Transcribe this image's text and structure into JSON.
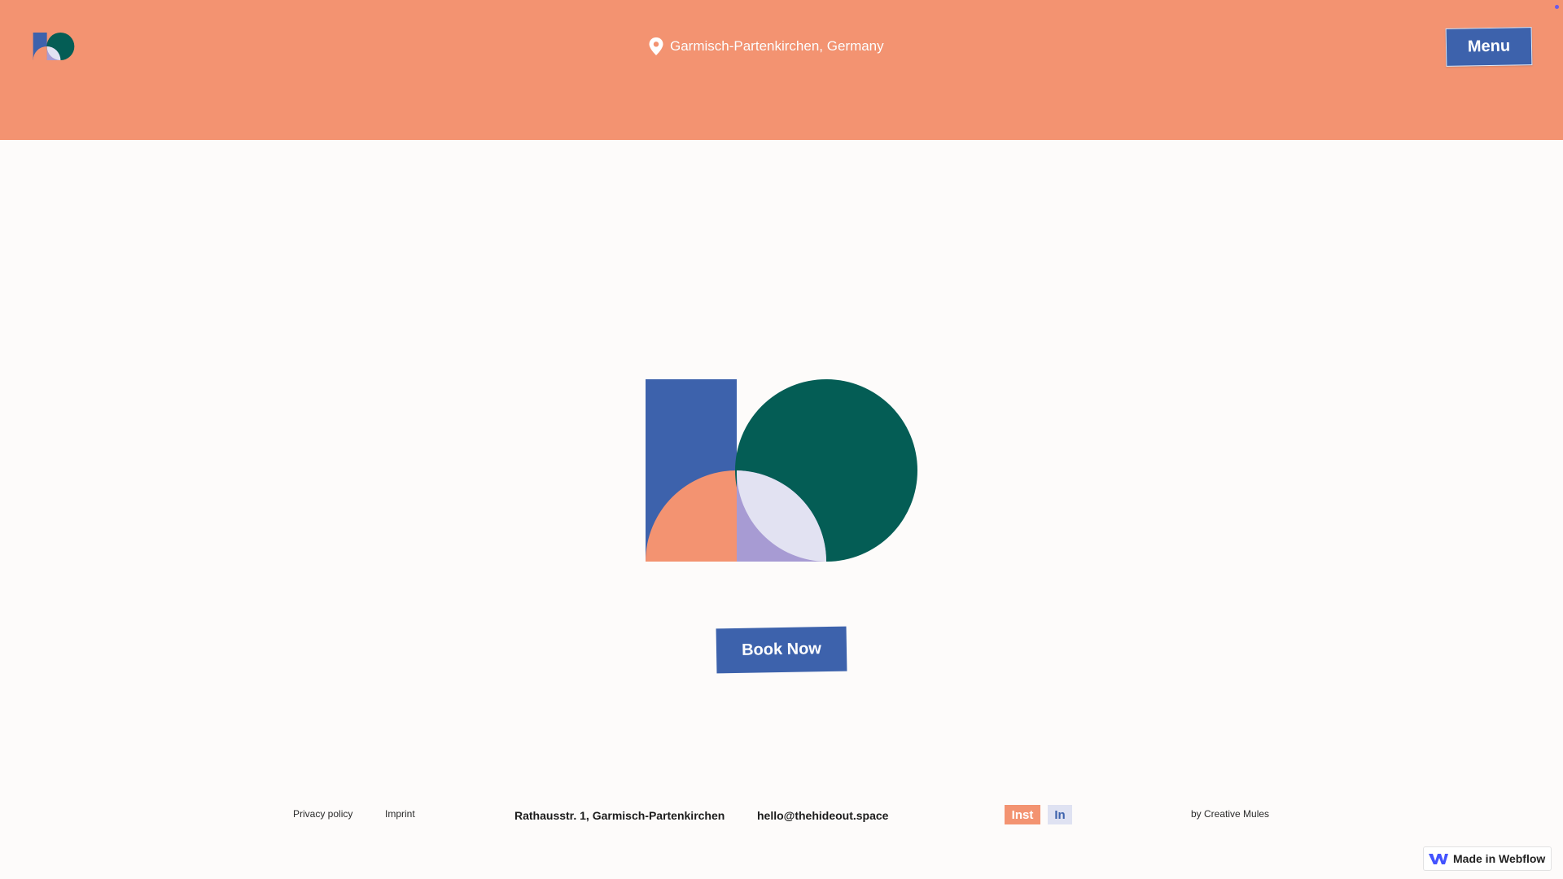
{
  "header": {
    "location": "Garmisch-Partenkirchen, Germany",
    "menu_label": "Menu"
  },
  "hero": {
    "book_label": "Book Now"
  },
  "footer": {
    "privacy": "Privacy policy",
    "imprint": "Imprint",
    "address": "Rathausstr. 1, Garmisch-Partenkirchen",
    "email": "hello@thehideout.space",
    "instagram": "Inst",
    "linkedin": "In",
    "credit": "by Creative Mules"
  },
  "badge": {
    "label": "Made in Webflow"
  },
  "colors": {
    "header_bg": "#f39371",
    "brand_blue": "#3d62ac",
    "brand_green": "#045d55",
    "brand_salmon": "#f39371",
    "brand_lavender": "#dfe2f2",
    "page_bg": "#fdfbfa"
  },
  "icons": {
    "logo": "hideout-logo-icon",
    "location": "location-pin-icon",
    "webflow": "webflow-logo-icon"
  }
}
